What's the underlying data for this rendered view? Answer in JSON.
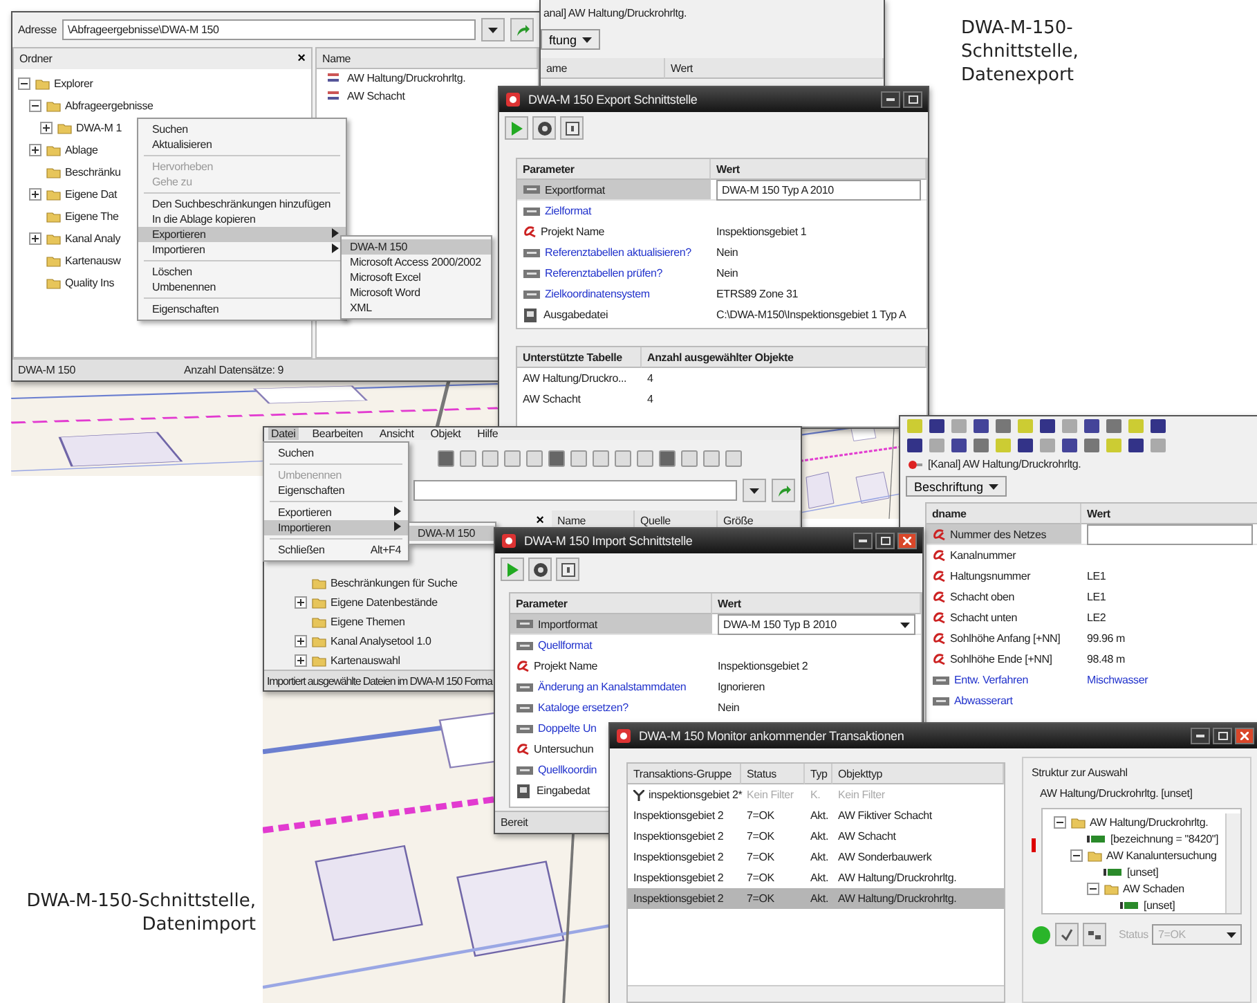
{
  "explorer": {
    "address_label": "Adresse",
    "address": "\\Abfrageergebnisse\\DWA-M 150",
    "folder_header": "Ordner",
    "close": "×",
    "name_header": "Name",
    "tree": [
      {
        "label": "Explorer",
        "expanded": true,
        "children": [
          {
            "label": "Abfrageergebnisse",
            "expanded": true,
            "children": [
              {
                "label": "DWA-M 1",
                "expanded": false
              }
            ]
          },
          {
            "label": "Ablage",
            "expanded": false
          },
          {
            "label": "Beschränku"
          },
          {
            "label": "Eigene Dat",
            "expanded": false
          },
          {
            "label": "Eigene The"
          },
          {
            "label": "Kanal Analy",
            "expanded": false
          },
          {
            "label": "Kartenausw"
          },
          {
            "label": "Quality Ins"
          }
        ]
      }
    ],
    "names": [
      "AW Haltung/Druckrohrltg.",
      "AW Schacht"
    ],
    "status": [
      "DWA-M 150",
      "Anzahl Datensätze: 9"
    ]
  },
  "context_menu": {
    "items": [
      {
        "kind": "item",
        "label": "Suchen",
        "disabled": false,
        "selected": false,
        "submenu": false
      },
      {
        "kind": "item",
        "label": "Aktualisieren",
        "disabled": false,
        "selected": false,
        "submenu": false
      },
      {
        "kind": "separator"
      },
      {
        "kind": "item",
        "label": "Hervorheben",
        "disabled": true,
        "selected": false,
        "submenu": false
      },
      {
        "kind": "item",
        "label": "Gehe zu",
        "disabled": true,
        "selected": false,
        "submenu": false
      },
      {
        "kind": "separator"
      },
      {
        "kind": "item",
        "label": "Den Suchbeschränkungen hinzufügen",
        "disabled": false,
        "selected": false,
        "submenu": false
      },
      {
        "kind": "item",
        "label": "In die Ablage kopieren",
        "disabled": false,
        "selected": false,
        "submenu": false
      },
      {
        "kind": "item",
        "label": "Exportieren",
        "disabled": false,
        "selected": true,
        "submenu": true
      },
      {
        "kind": "item",
        "label": "Importieren",
        "disabled": false,
        "selected": false,
        "submenu": true
      },
      {
        "kind": "separator"
      },
      {
        "kind": "item",
        "label": "Löschen",
        "disabled": false,
        "selected": false,
        "submenu": false
      },
      {
        "kind": "item",
        "label": "Umbenennen",
        "disabled": false,
        "selected": false,
        "submenu": false
      },
      {
        "kind": "separator"
      },
      {
        "kind": "item",
        "label": "Eigenschaften",
        "disabled": false,
        "selected": false,
        "submenu": false
      }
    ],
    "submenu": [
      {
        "label": "DWA-M 150",
        "selected": true
      },
      {
        "label": "Microsoft Access 2000/2002",
        "selected": false
      },
      {
        "label": "Microsoft Excel",
        "selected": false
      },
      {
        "label": "Microsoft Word",
        "selected": false
      },
      {
        "label": "XML",
        "selected": false
      }
    ]
  },
  "attribute_window_back": {
    "layer": "anal] AW Haltung/Druckrohrltg.",
    "label_button": "ftung",
    "columns": [
      "ame",
      "Wert"
    ]
  },
  "export_window": {
    "title": "DWA-M 150 Export Schnittstelle",
    "columns": [
      "Parameter",
      "Wert"
    ],
    "rows": [
      {
        "kind": "setting",
        "label": "Exportformat",
        "value": "DWA-M 150 Typ A 2010",
        "selected": true
      },
      {
        "kind": "option",
        "label": "Zielformat",
        "value": "",
        "selected": false
      },
      {
        "kind": "required",
        "label": "Projekt Name",
        "value": "Inspektionsgebiet 1",
        "selected": false
      },
      {
        "kind": "option",
        "label": "Referenztabellen aktualisieren?",
        "value": "Nein",
        "selected": false
      },
      {
        "kind": "option",
        "label": "Referenztabellen prüfen?",
        "value": "Nein",
        "selected": false
      },
      {
        "kind": "option",
        "label": "Zielkoordinatensystem",
        "value": "ETRS89 Zone 31",
        "selected": false
      },
      {
        "kind": "file",
        "label": "Ausgabedatei",
        "value": "C:\\DWA-M150\\Inspektionsgebiet 1 Typ A",
        "selected": false
      }
    ],
    "table": {
      "columns": [
        "Unterstützte Tabelle",
        "Anzahl ausgewählter Objekte"
      ],
      "rows": [
        [
          "AW Haltung/Druckro...",
          "4"
        ],
        [
          "AW Schacht",
          "4"
        ]
      ]
    }
  },
  "caption_export": "DWA-M-150-Schnittstelle, Datenexport",
  "explorer_import": {
    "menu": [
      {
        "label": "Datei",
        "selected": true
      },
      {
        "label": "Bearbeiten",
        "selected": false
      },
      {
        "label": "Ansicht",
        "selected": false
      },
      {
        "label": "Objekt",
        "selected": false
      },
      {
        "label": "Hilfe",
        "selected": false
      }
    ],
    "close": "×",
    "columns": [
      "Name",
      "Quelle",
      "Größe"
    ],
    "tree": [
      {
        "label": "Beschränkungen für Suche"
      },
      {
        "label": "Eigene Datenbestände",
        "expanded": false
      },
      {
        "label": "Eigene Themen"
      },
      {
        "label": "Kanal Analysetool 1.0",
        "expanded": false
      },
      {
        "label": "Kartenauswahl",
        "expanded": false
      }
    ],
    "status": "Importiert ausgewählte Dateien im DWA-M 150 Forma"
  },
  "file_menu": {
    "items": [
      {
        "kind": "item",
        "label": "Suchen",
        "disabled": false,
        "selected": false,
        "submenu": false
      },
      {
        "kind": "separator"
      },
      {
        "kind": "item",
        "label": "Umbenennen",
        "disabled": true,
        "selected": false,
        "submenu": false
      },
      {
        "kind": "item",
        "label": "Eigenschaften",
        "disabled": false,
        "selected": false,
        "submenu": false
      },
      {
        "kind": "separator"
      },
      {
        "kind": "item",
        "label": "Exportieren",
        "disabled": false,
        "selected": false,
        "submenu": true
      },
      {
        "kind": "item",
        "label": "Importieren",
        "disabled": false,
        "selected": true,
        "submenu": true
      },
      {
        "kind": "separator"
      },
      {
        "kind": "item",
        "label": "Schließen",
        "shortcut": "Alt+F4",
        "disabled": false,
        "selected": false,
        "submenu": false
      }
    ],
    "submenu": [
      {
        "label": "DWA-M 150",
        "selected": true
      }
    ]
  },
  "attribute_window": {
    "layer": "[Kanal] AW Haltung/Druckrohrltg.",
    "label_button": "Beschriftung",
    "columns": [
      "dname",
      "Wert"
    ],
    "rows": [
      {
        "kind": "required",
        "label": "Nummer des Netzes",
        "value": "",
        "selected": true
      },
      {
        "kind": "required",
        "label": "Kanalnummer",
        "value": "",
        "selected": false
      },
      {
        "kind": "required",
        "label": "Haltungsnummer",
        "value": "LE1",
        "selected": false
      },
      {
        "kind": "required",
        "label": "Schacht oben",
        "value": "LE1",
        "selected": false
      },
      {
        "kind": "required",
        "label": "Schacht unten",
        "value": "LE2",
        "selected": false
      },
      {
        "kind": "required",
        "label": "Sohlhöhe Anfang [+NN]",
        "value": "99.96 m",
        "selected": false
      },
      {
        "kind": "required",
        "label": "Sohlhöhe Ende [+NN]",
        "value": "98.48 m",
        "selected": false
      },
      {
        "kind": "option",
        "label": "Entw. Verfahren",
        "value": "Mischwasser",
        "selected": false
      },
      {
        "kind": "option",
        "label": "Abwasserart",
        "value": "",
        "selected": false
      }
    ]
  },
  "import_window": {
    "title": "DWA-M 150 Import Schnittstelle",
    "columns": [
      "Parameter",
      "Wert"
    ],
    "rows": [
      {
        "kind": "setting",
        "label": "Importformat",
        "value": "DWA-M 150 Typ B 2010",
        "selected": true
      },
      {
        "kind": "option",
        "label": "Quellformat",
        "value": "",
        "selected": false
      },
      {
        "kind": "required",
        "label": "Projekt Name",
        "value": "Inspektionsgebiet  2",
        "selected": false
      },
      {
        "kind": "option",
        "label": "Änderung an Kanalstammdaten",
        "value": "Ignorieren",
        "selected": false
      },
      {
        "kind": "option",
        "label": "Kataloge ersetzen?",
        "value": "Nein",
        "selected": false
      },
      {
        "kind": "option",
        "label": "Doppelte Un",
        "value": "",
        "selected": false
      },
      {
        "kind": "required",
        "label": "Untersuchun",
        "value": "",
        "selected": false
      },
      {
        "kind": "option",
        "label": "Quellkoordin",
        "value": "",
        "selected": false
      },
      {
        "kind": "file",
        "label": "Eingabedat",
        "value": "",
        "selected": false
      }
    ],
    "status": "Bereit"
  },
  "monitor_window": {
    "title": "DWA-M 150 Monitor ankommender Transaktionen",
    "columns": [
      "Transaktions-Gruppe",
      "Status",
      "Typ",
      "Objekttyp"
    ],
    "rows": [
      {
        "kind": "filter",
        "cells": [
          "inspektionsgebiet 2*",
          "Kein Filter",
          "K.",
          "Kein Filter"
        ],
        "selected": false
      },
      {
        "kind": "data",
        "cells": [
          "Inspektionsgebiet 2",
          "7=OK",
          "Akt.",
          "AW Fiktiver Schacht"
        ],
        "selected": false
      },
      {
        "kind": "data",
        "cells": [
          "Inspektionsgebiet 2",
          "7=OK",
          "Akt.",
          "AW Schacht"
        ],
        "selected": false
      },
      {
        "kind": "data",
        "cells": [
          "Inspektionsgebiet 2",
          "7=OK",
          "Akt.",
          "AW Sonderbauwerk"
        ],
        "selected": false
      },
      {
        "kind": "data",
        "cells": [
          "Inspektionsgebiet 2",
          "7=OK",
          "Akt.",
          "AW Haltung/Druckrohrltg."
        ],
        "selected": false
      },
      {
        "kind": "data",
        "cells": [
          "Inspektionsgebiet 2",
          "7=OK",
          "Akt.",
          "AW Haltung/Druckrohrltg."
        ],
        "selected": true
      }
    ],
    "group_title": "Struktur zur Auswahl",
    "selection": "AW Haltung/Druckrohrltg. [unset]",
    "tree": [
      {
        "kind": "folder",
        "label": "AW Haltung/Druckrohrltg.",
        "expanded": true,
        "children": [
          {
            "kind": "filter",
            "label": "[bezeichnung = \"8420\"]"
          },
          {
            "kind": "folder",
            "label": "AW Kanaluntersuchung",
            "expanded": true,
            "children": [
              {
                "kind": "filter",
                "label": "[unset]"
              },
              {
                "kind": "folder",
                "label": "AW Schaden",
                "expanded": true,
                "children": [
                  {
                    "kind": "filter",
                    "label": "[unset]"
                  }
                ]
              }
            ]
          }
        ]
      }
    ],
    "status_label": "Status",
    "status_value": "7=OK",
    "status_disabled": true
  },
  "caption_import": "DWA-M-150-Schnittstelle, Datenimport"
}
